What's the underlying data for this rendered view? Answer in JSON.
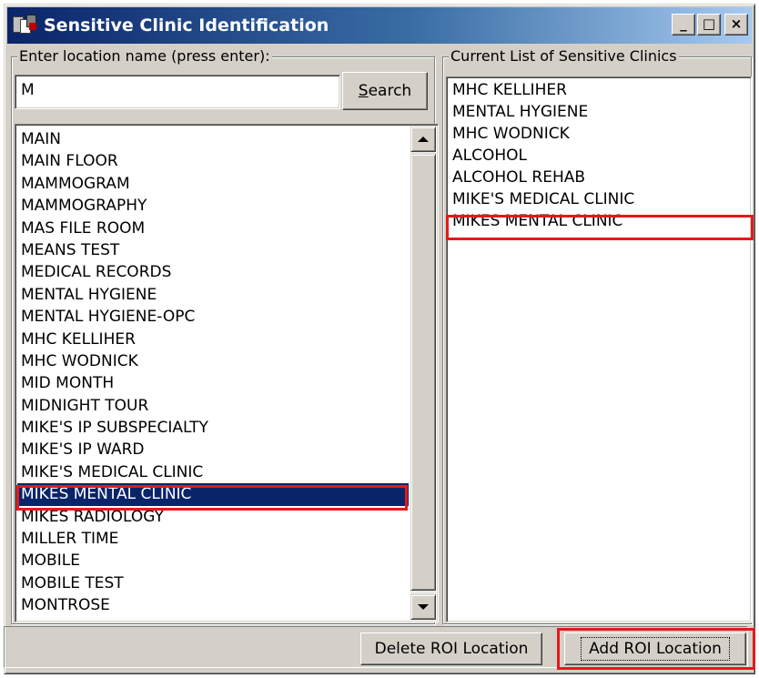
{
  "window": {
    "title": "Sensitive Clinic Identification",
    "controls": {
      "minimize": "_",
      "maximize": "□",
      "close": "×"
    }
  },
  "search": {
    "legend": "Enter location name (press enter):",
    "value": "M",
    "button_label": "Search",
    "button_mnemonic": "S"
  },
  "locations": {
    "items": [
      "MAIN",
      "MAIN FLOOR",
      "MAMMOGRAM",
      "MAMMOGRAPHY",
      "MAS FILE ROOM",
      "MEANS TEST",
      "MEDICAL RECORDS",
      "MENTAL HYGIENE",
      "MENTAL HYGIENE-OPC",
      "MHC KELLIHER",
      "MHC WODNICK",
      "MID MONTH",
      "MIDNIGHT TOUR",
      "MIKE'S IP SUBSPECIALTY",
      "MIKE'S IP WARD",
      "MIKE'S MEDICAL CLINIC",
      "MIKES MENTAL CLINIC",
      "MIKES RADIOLOGY",
      "MILLER TIME",
      "MOBILE",
      "MOBILE TEST",
      "MONTROSE"
    ],
    "selected": "MIKES MENTAL CLINIC"
  },
  "sensitive": {
    "legend": "Current List of Sensitive Clinics",
    "items": [
      "MHC KELLIHER",
      "MENTAL HYGIENE",
      "MHC WODNICK",
      "ALCOHOL",
      "ALCOHOL REHAB",
      "MIKE'S MEDICAL CLINIC",
      "MIKES MENTAL CLINIC"
    ],
    "highlighted": "MIKES MENTAL CLINIC"
  },
  "actions": {
    "delete_label": "Delete ROI Location",
    "add_label": "Add ROI Location"
  },
  "colors": {
    "titlebar_start": "#0a246a",
    "titlebar_end": "#a6caf0",
    "selection": "#0a246a",
    "callout_red": "#e31b1b",
    "face": "#d4d0c8"
  }
}
